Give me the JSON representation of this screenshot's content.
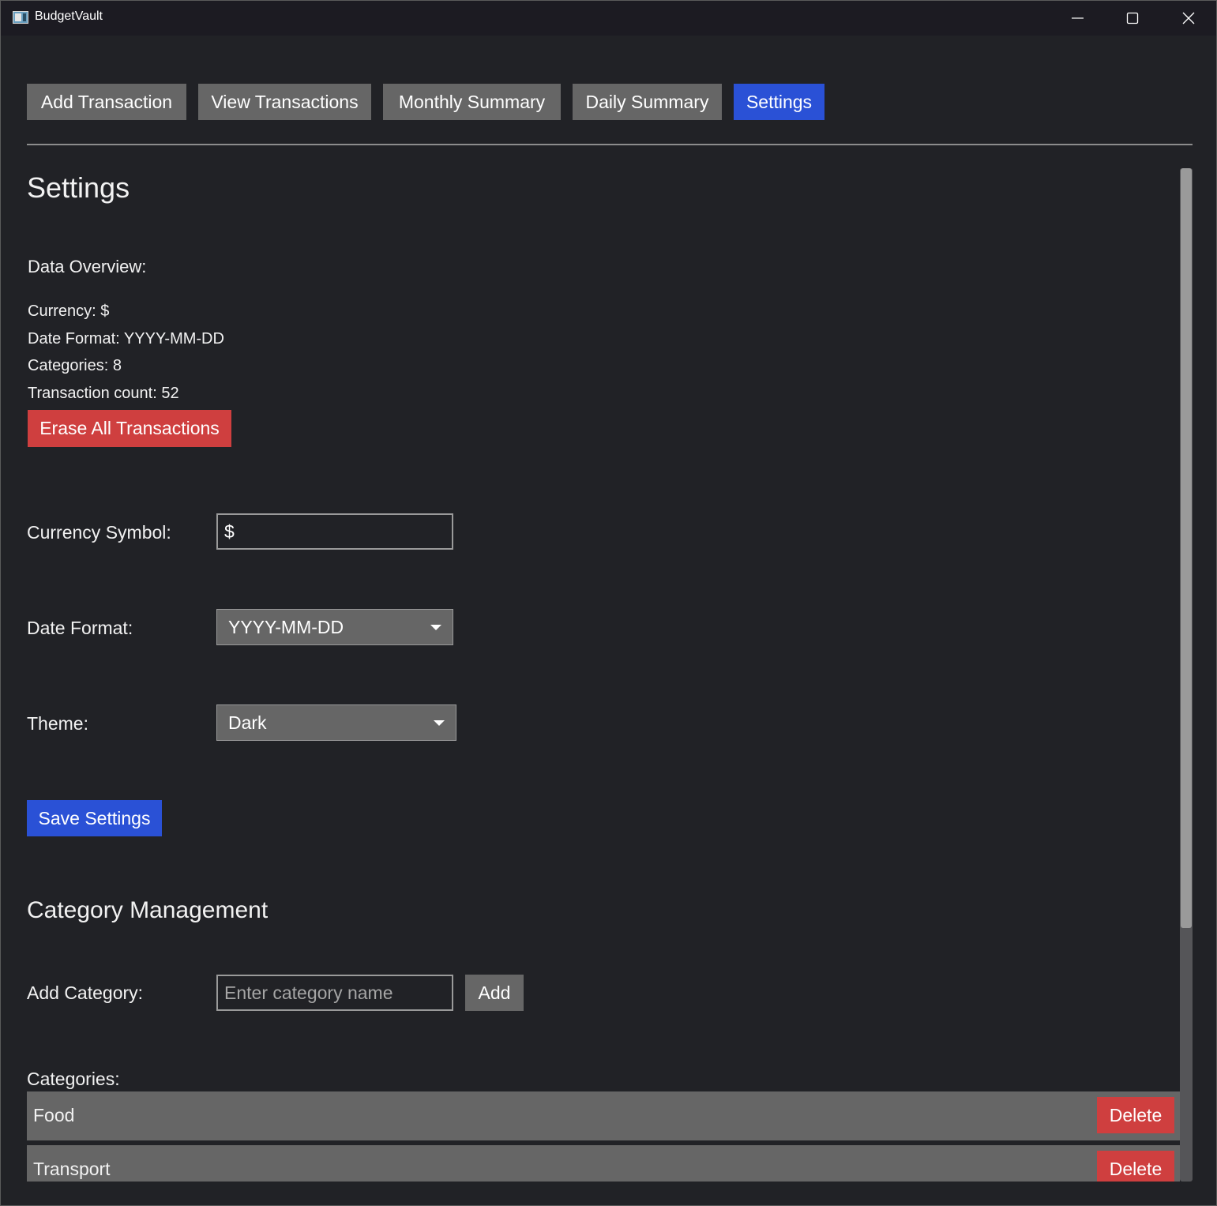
{
  "window": {
    "title": "BudgetVault",
    "controls": {
      "minimize": "minimize-icon",
      "maximize": "maximize-icon",
      "close": "close-icon"
    }
  },
  "tabs": [
    {
      "label": "Add Transaction",
      "active": false
    },
    {
      "label": "View Transactions",
      "active": false
    },
    {
      "label": "Monthly Summary",
      "active": false
    },
    {
      "label": "Daily Summary",
      "active": false
    },
    {
      "label": "Settings",
      "active": true
    }
  ],
  "settings": {
    "title": "Settings",
    "overview": {
      "label": "Data Overview:",
      "currency": "Currency: $",
      "date_format": "Date Format: YYYY-MM-DD",
      "categories": "Categories: 8",
      "transaction_count": "Transaction count: 52"
    },
    "erase_button": "Erase All Transactions",
    "currency_symbol": {
      "label": "Currency Symbol:",
      "value": "$"
    },
    "date_format": {
      "label": "Date Format:",
      "selected": "YYYY-MM-DD"
    },
    "theme": {
      "label": "Theme:",
      "selected": "Dark"
    },
    "save_button": "Save Settings"
  },
  "category_management": {
    "title": "Category Management",
    "add_label": "Add Category:",
    "add_placeholder": "Enter category name",
    "add_button": "Add",
    "list_label": "Categories:",
    "delete_label": "Delete",
    "items": [
      {
        "name": "Food"
      },
      {
        "name": "Transport"
      }
    ]
  },
  "colors": {
    "background": "#212226",
    "accent_blue": "#2a51d6",
    "danger_red": "#cf3f3f",
    "neutral_gray": "#666666"
  }
}
